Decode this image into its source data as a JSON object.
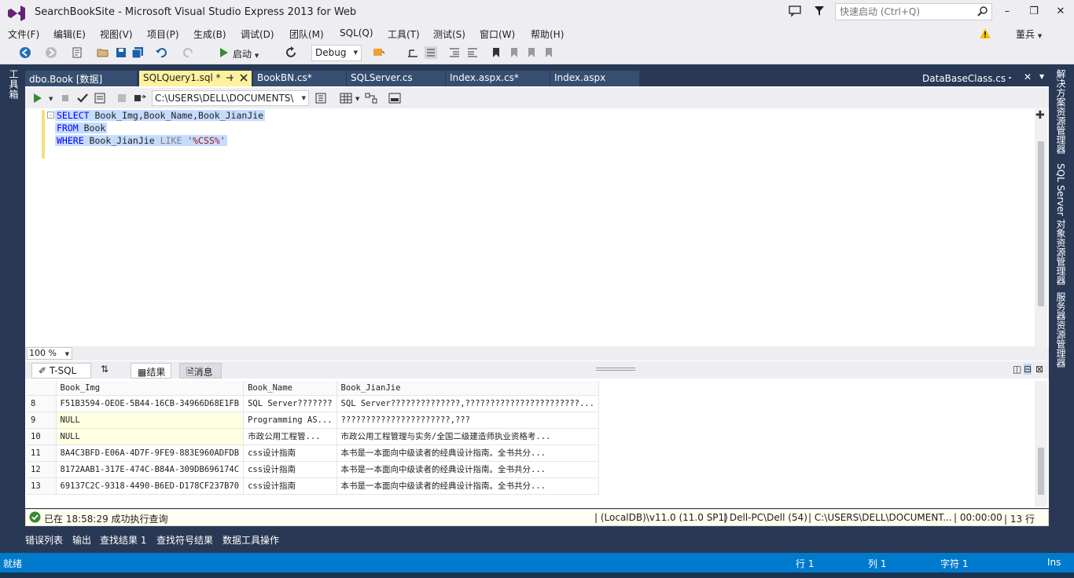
{
  "window": {
    "title": "SearchBookSite - Microsoft Visual Studio Express 2013 for Web",
    "quick_launch_placeholder": "快速启动 (Ctrl+Q)",
    "user": "董兵"
  },
  "menu": [
    "文件(F)",
    "编辑(E)",
    "视图(V)",
    "项目(P)",
    "生成(B)",
    "调试(D)",
    "团队(M)",
    "SQL(Q)",
    "工具(T)",
    "测试(S)",
    "窗口(W)",
    "帮助(H)"
  ],
  "toolbar": {
    "start_label": "启动",
    "config": "Debug"
  },
  "left_strip": {
    "toolbox": "工具箱"
  },
  "right_strip": [
    "解决方案资源管理器",
    "SQL Server 对象资源管理器",
    "服务器资源管理器"
  ],
  "tabs": [
    "dbo.Book [数据]",
    "SQLQuery1.sql *",
    "BookBN.cs*",
    "SQLServer.cs",
    "Index.aspx.cs*",
    "Index.aspx"
  ],
  "tab_right": "DataBaseClass.cs",
  "sql_toolbar": {
    "connection": "C:\\USERS\\DELL\\DOCUMENTS\\"
  },
  "code": {
    "line1_kw": "SELECT",
    "line1_rest": " Book_Img,Book_Name,Book_JianJie",
    "line2_kw": "FROM",
    "line2_rest": " Book",
    "line3_kw": "WHERE",
    "line3_mid": " Book_JianJie ",
    "line3_like": "LIKE",
    "line3_str": " '%CSS%'"
  },
  "zoom": "100 %",
  "results_tabs": {
    "tsql": "T-SQL",
    "results": "结果",
    "messages": "消息"
  },
  "grid": {
    "columns": [
      "Book_Img",
      "Book_Name",
      "Book_JianJie"
    ],
    "rows": [
      {
        "n": "8",
        "img": "F51B3594-OEOE-5B44-16CB-34966D68E1FB",
        "name": "SQL Server???????",
        "jj": "SQL Server??????????????,???????????????????????..."
      },
      {
        "n": "9",
        "img": "NULL",
        "name": "Programming AS...",
        "jj": "??????????????????????,???"
      },
      {
        "n": "10",
        "img": "NULL",
        "name": "市政公用工程管...",
        "jj": "市政公用工程管理与实务/全国二级建造师执业资格考..."
      },
      {
        "n": "11",
        "img": "8A4C3BFD-E06A-4D7F-9FE9-883E960ADFDB",
        "name": "css设计指南",
        "jj": "本书是一本面向中级读者的经典设计指南。全书共分..."
      },
      {
        "n": "12",
        "img": "8172AAB1-317E-474C-B84A-309DB696174C",
        "name": "css设计指南",
        "jj": "本书是一本面向中级读者的经典设计指南。全书共分..."
      },
      {
        "n": "13",
        "img": "69137C2C-9318-4490-B6ED-D178CF237B70",
        "name": "css设计指南",
        "jj": "本书是一本面向中级读者的经典设计指南。全书共分..."
      }
    ]
  },
  "query_status": {
    "message": "已在 18:58:29 成功执行查询",
    "server": "(LocalDB)\\v11.0 (11.0 SP1)",
    "user": "Dell-PC\\Dell (54)",
    "path": "C:\\USERS\\DELL\\DOCUMENT...",
    "time": "00:00:00",
    "rows": "13 行"
  },
  "bottom_tabs": [
    "错误列表",
    "输出",
    "查找结果 1",
    "查找符号结果",
    "数据工具操作"
  ],
  "status": {
    "ready": "就绪",
    "line": "行 1",
    "col": "列 1",
    "char": "字符 1",
    "mode": "Ins"
  },
  "colors": {
    "accent": "#007acc",
    "frame": "#293955",
    "active_tab": "#fff29d"
  }
}
